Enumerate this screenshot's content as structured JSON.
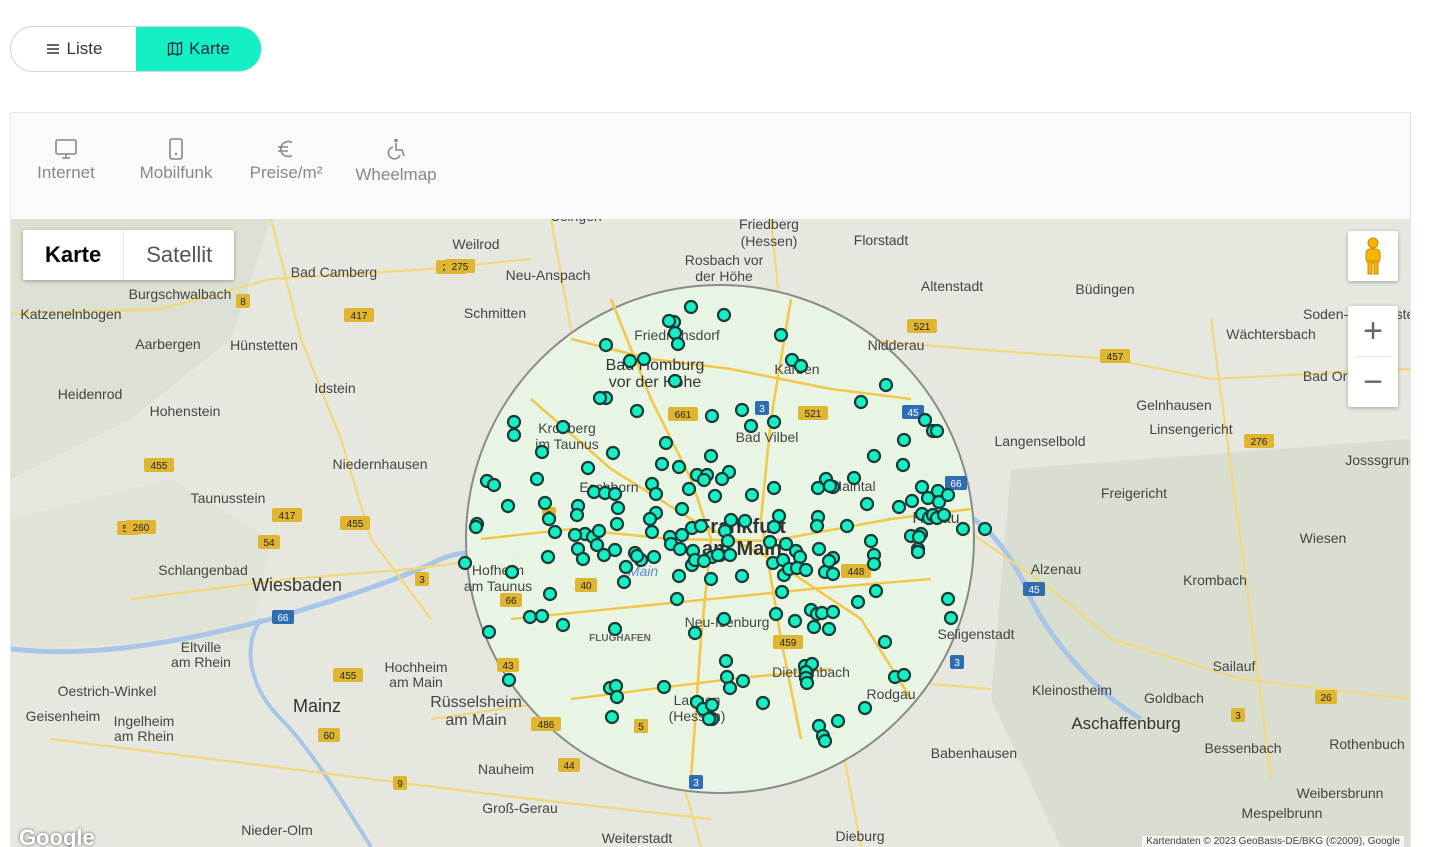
{
  "view_toggle": {
    "list_label": "Liste",
    "map_label": "Karte",
    "active": "map"
  },
  "layers": [
    {
      "label": "Internet",
      "icon": "monitor-icon"
    },
    {
      "label": "Mobilfunk",
      "icon": "mobile-phone-icon"
    },
    {
      "label": "Preise/m²",
      "icon": "euro-icon"
    },
    {
      "label": "Wheelmap",
      "icon": "wheelchair-icon"
    }
  ],
  "map": {
    "type_buttons": {
      "map": "Karte",
      "satellite": "Satellit"
    },
    "zoom_in": "+",
    "zoom_out": "−",
    "logo": "Google",
    "attribution": "Kartendaten © 2023 GeoBasis-DE/BKG (©2009), Google",
    "colors": {
      "marker_fill": "#14f0c4",
      "marker_stroke": "#1b3a36",
      "radius_fill": "#e9f6e4"
    },
    "places": [
      {
        "name": "Friedberg (Hessen)",
        "lines": [
          "Friedberg",
          "(Hessen)"
        ]
      },
      {
        "name": "Weilrod"
      },
      {
        "name": "Florstadt"
      },
      {
        "name": "Bad Camberg"
      },
      {
        "name": "Neu-Anspach"
      },
      {
        "name": "Rosbach vor der Höhe",
        "lines": [
          "Rosbach vor",
          "der Höhe"
        ]
      },
      {
        "name": "Burgschwalbach"
      },
      {
        "name": "Altenstadt"
      },
      {
        "name": "Büdingen"
      },
      {
        "name": "Katzenelnbogen"
      },
      {
        "name": "Schmitten"
      },
      {
        "name": "Friedrichsdorf"
      },
      {
        "name": "Aarbergen"
      },
      {
        "name": "Hünstetten"
      },
      {
        "name": "Nidderau"
      },
      {
        "name": "Wächtersbach"
      },
      {
        "name": "Bad Homburg vor der Höhe",
        "lines": [
          "Bad Homburg",
          "vor der Höhe"
        ]
      },
      {
        "name": "Karben"
      },
      {
        "name": "Heidenrod"
      },
      {
        "name": "Idstein"
      },
      {
        "name": "Hohenstein"
      },
      {
        "name": "Gelnhausen"
      },
      {
        "name": "Kronberg im Taunus",
        "lines": [
          "Kronberg",
          "im Taunus"
        ]
      },
      {
        "name": "Bad Vilbel"
      },
      {
        "name": "Langenselbold"
      },
      {
        "name": "Linsengericht"
      },
      {
        "name": "Niedernhausen"
      },
      {
        "name": "Eschborn"
      },
      {
        "name": "Maintal"
      },
      {
        "name": "Freigericht"
      },
      {
        "name": "Taunusstein"
      },
      {
        "name": "Frankfurt am Main",
        "lines": [
          "Frankfurt",
          "am Main"
        ]
      },
      {
        "name": "Hanau"
      },
      {
        "name": "Hofheim am Taunus",
        "lines": [
          "Hofheim",
          "am Taunus"
        ]
      },
      {
        "name": "Wiesen"
      },
      {
        "name": "Schlangenbad"
      },
      {
        "name": "Wiesbaden"
      },
      {
        "name": "Alzenau"
      },
      {
        "name": "Krombach"
      },
      {
        "name": "Neu-Isenburg"
      },
      {
        "name": "Seligenstadt"
      },
      {
        "name": "Eltville am Rhein",
        "lines": [
          "Eltville",
          "am Rhein"
        ]
      },
      {
        "name": "Hochheim am Main",
        "lines": [
          "Hochheim",
          "am Main"
        ]
      },
      {
        "name": "Dietzenbach"
      },
      {
        "name": "Sailauf"
      },
      {
        "name": "Oestrich-Winkel"
      },
      {
        "name": "Mainz"
      },
      {
        "name": "Rüsselsheim am Main",
        "lines": [
          "Rüsselsheim",
          "am Main"
        ]
      },
      {
        "name": "Rodgau"
      },
      {
        "name": "Kleinostheim"
      },
      {
        "name": "Goldbach"
      },
      {
        "name": "Geisenheim"
      },
      {
        "name": "Ingelheim am Rhein",
        "lines": [
          "Ingelheim",
          "am Rhein"
        ]
      },
      {
        "name": "Langen (Hessen)",
        "lines": [
          "Langen",
          "(Hessen)"
        ]
      },
      {
        "name": "Aschaffenburg"
      },
      {
        "name": "Rothenbuch"
      },
      {
        "name": "Babenhausen"
      },
      {
        "name": "Bessenbach"
      },
      {
        "name": "Nauheim"
      },
      {
        "name": "Weibersbrunn"
      },
      {
        "name": "Groß-Gerau"
      },
      {
        "name": "Mespelbrunn"
      },
      {
        "name": "Nieder-Olm"
      },
      {
        "name": "Weiterstadt"
      },
      {
        "name": "Dieburg"
      },
      {
        "name": "Josssgrund"
      },
      {
        "name": "Bad Orb"
      },
      {
        "name": "Soden-Salmünster"
      },
      {
        "name": "Usingen"
      },
      {
        "name": "Flughafen"
      },
      {
        "name": "Main"
      }
    ],
    "road_shields": [
      "275",
      "417",
      "8",
      "455",
      "54",
      "260",
      "54",
      "417",
      "455",
      "3",
      "66",
      "44",
      "43",
      "40",
      "486",
      "5",
      "3",
      "661",
      "3",
      "521",
      "521",
      "45",
      "66",
      "448",
      "459",
      "3",
      "45",
      "3",
      "26",
      "60",
      "9",
      "455",
      "66",
      "276",
      "457",
      "275",
      "8",
      "5"
    ]
  }
}
